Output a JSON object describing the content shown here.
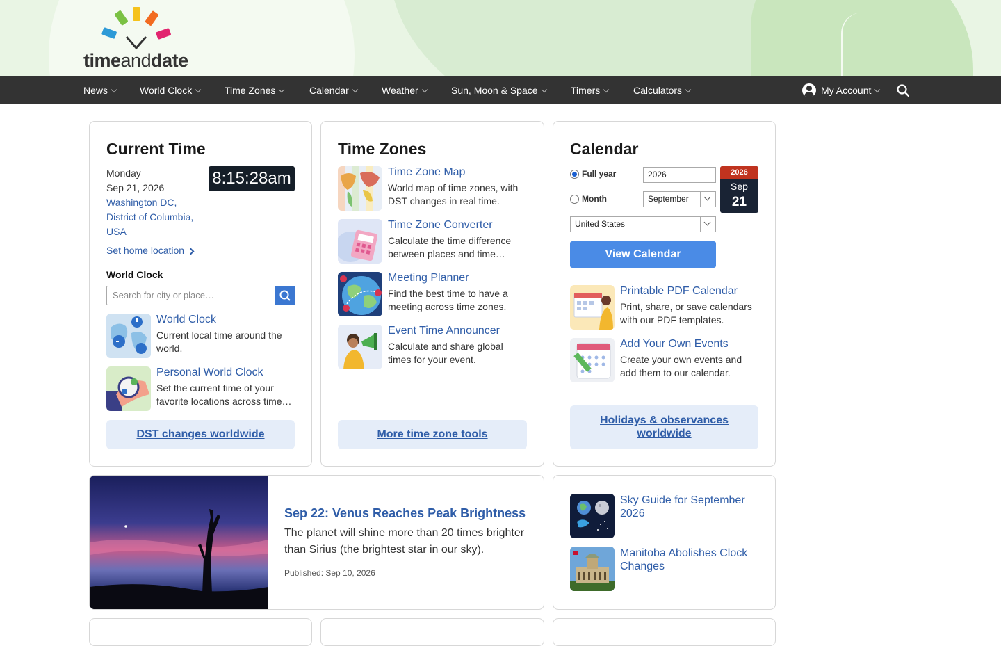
{
  "brand": {
    "logo_text_a": "time",
    "logo_text_b": "and",
    "logo_text_c": "date"
  },
  "nav": {
    "items": [
      "News",
      "World Clock",
      "Time Zones",
      "Calendar",
      "Weather",
      "Sun, Moon & Space",
      "Timers",
      "Calculators"
    ],
    "account": "My Account"
  },
  "current_time": {
    "title": "Current Time",
    "weekday": "Monday",
    "date": "Sep 21, 2026",
    "location_line1": "Washington DC,",
    "location_line2": "District of Columbia,",
    "location_line3": "USA",
    "clock": "8:15:28am",
    "set_home": "Set home location",
    "world_clock_label": "World Clock",
    "search_placeholder": "Search for city or place…",
    "tools": [
      {
        "title": "World Clock",
        "desc": "Current local time around the world."
      },
      {
        "title": "Personal World Clock",
        "desc": "Set the current time of your favorite locations across time…"
      }
    ],
    "button": "DST changes worldwide"
  },
  "time_zones": {
    "title": "Time Zones",
    "tools": [
      {
        "title": "Time Zone Map",
        "desc": "World map of time zones, with DST changes in real time."
      },
      {
        "title": "Time Zone Converter",
        "desc": "Calculate the time difference between places and time…"
      },
      {
        "title": "Meeting Planner",
        "desc": "Find the best time to have a meeting across time zones."
      },
      {
        "title": "Event Time Announcer",
        "desc": "Calculate and share global times for your event."
      }
    ],
    "button": "More time zone tools"
  },
  "calendar": {
    "title": "Calendar",
    "full_year_label": "Full year",
    "month_label": "Month",
    "year_value": "2026",
    "month_value": "September",
    "country_value": "United States",
    "icon_year": "2026",
    "icon_month": "Sep",
    "icon_day": "21",
    "view_button": "View Calendar",
    "tools": [
      {
        "title": "Printable PDF Calendar",
        "desc": "Print, share, or save calendars with our PDF templates."
      },
      {
        "title": "Add Your Own Events",
        "desc": "Create your own events and add them to our calendar."
      }
    ],
    "button_line1": "Holidays & observances",
    "button_line2": "worldwide"
  },
  "feature": {
    "headline": "Sep 22: Venus Reaches Peak Brightness",
    "body": "The planet will shine more than 20 times brighter than Sirius (the brightest star in our sky).",
    "published": "Published: Sep 10, 2026"
  },
  "side_news": [
    {
      "title": "Sky Guide for September 2026"
    },
    {
      "title": "Manitoba Abolishes Clock Changes"
    }
  ]
}
